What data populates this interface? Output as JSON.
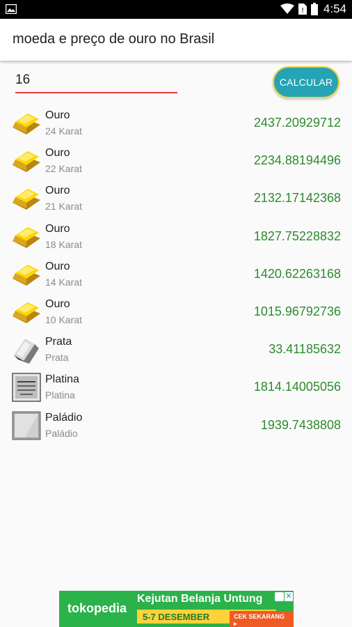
{
  "status_bar": {
    "time": "4:54"
  },
  "app_bar": {
    "title": "moeda e preço de ouro no Brasil"
  },
  "form": {
    "amount_value": "16",
    "calculate_label": "CALCULAR"
  },
  "items": [
    {
      "name": "Ouro",
      "subtitle": "24 Karat",
      "price": "2437.20929712",
      "icon": "gold-bar-icon"
    },
    {
      "name": "Ouro",
      "subtitle": "22 Karat",
      "price": "2234.88194496",
      "icon": "gold-bar-icon"
    },
    {
      "name": "Ouro",
      "subtitle": "21 Karat",
      "price": "2132.17142368",
      "icon": "gold-bar-icon"
    },
    {
      "name": "Ouro",
      "subtitle": "18 Karat",
      "price": "1827.75228832",
      "icon": "gold-bar-icon"
    },
    {
      "name": "Ouro",
      "subtitle": "14 Karat",
      "price": "1420.62263168",
      "icon": "gold-bar-icon"
    },
    {
      "name": "Ouro",
      "subtitle": "10 Karat",
      "price": "1015.96792736",
      "icon": "gold-bar-icon"
    },
    {
      "name": "Prata",
      "subtitle": "Prata",
      "price": "33.41185632",
      "icon": "silver-bar-icon"
    },
    {
      "name": "Platina",
      "subtitle": "Platina",
      "price": "1814.14005056",
      "icon": "platinum-bar-icon"
    },
    {
      "name": "Paládio",
      "subtitle": "Paládio",
      "price": "1939.7438808",
      "icon": "palladium-bar-icon"
    }
  ],
  "ad": {
    "brand": "tokopedia",
    "headline": "Kejutan Belanja Untung",
    "dates": "5-7 DESEMBER",
    "cta": "CEK SEKARANG ▸"
  },
  "colors": {
    "price_green": "#2e8b2e",
    "button_teal": "#26a3b4",
    "input_underline": "#e53935"
  }
}
